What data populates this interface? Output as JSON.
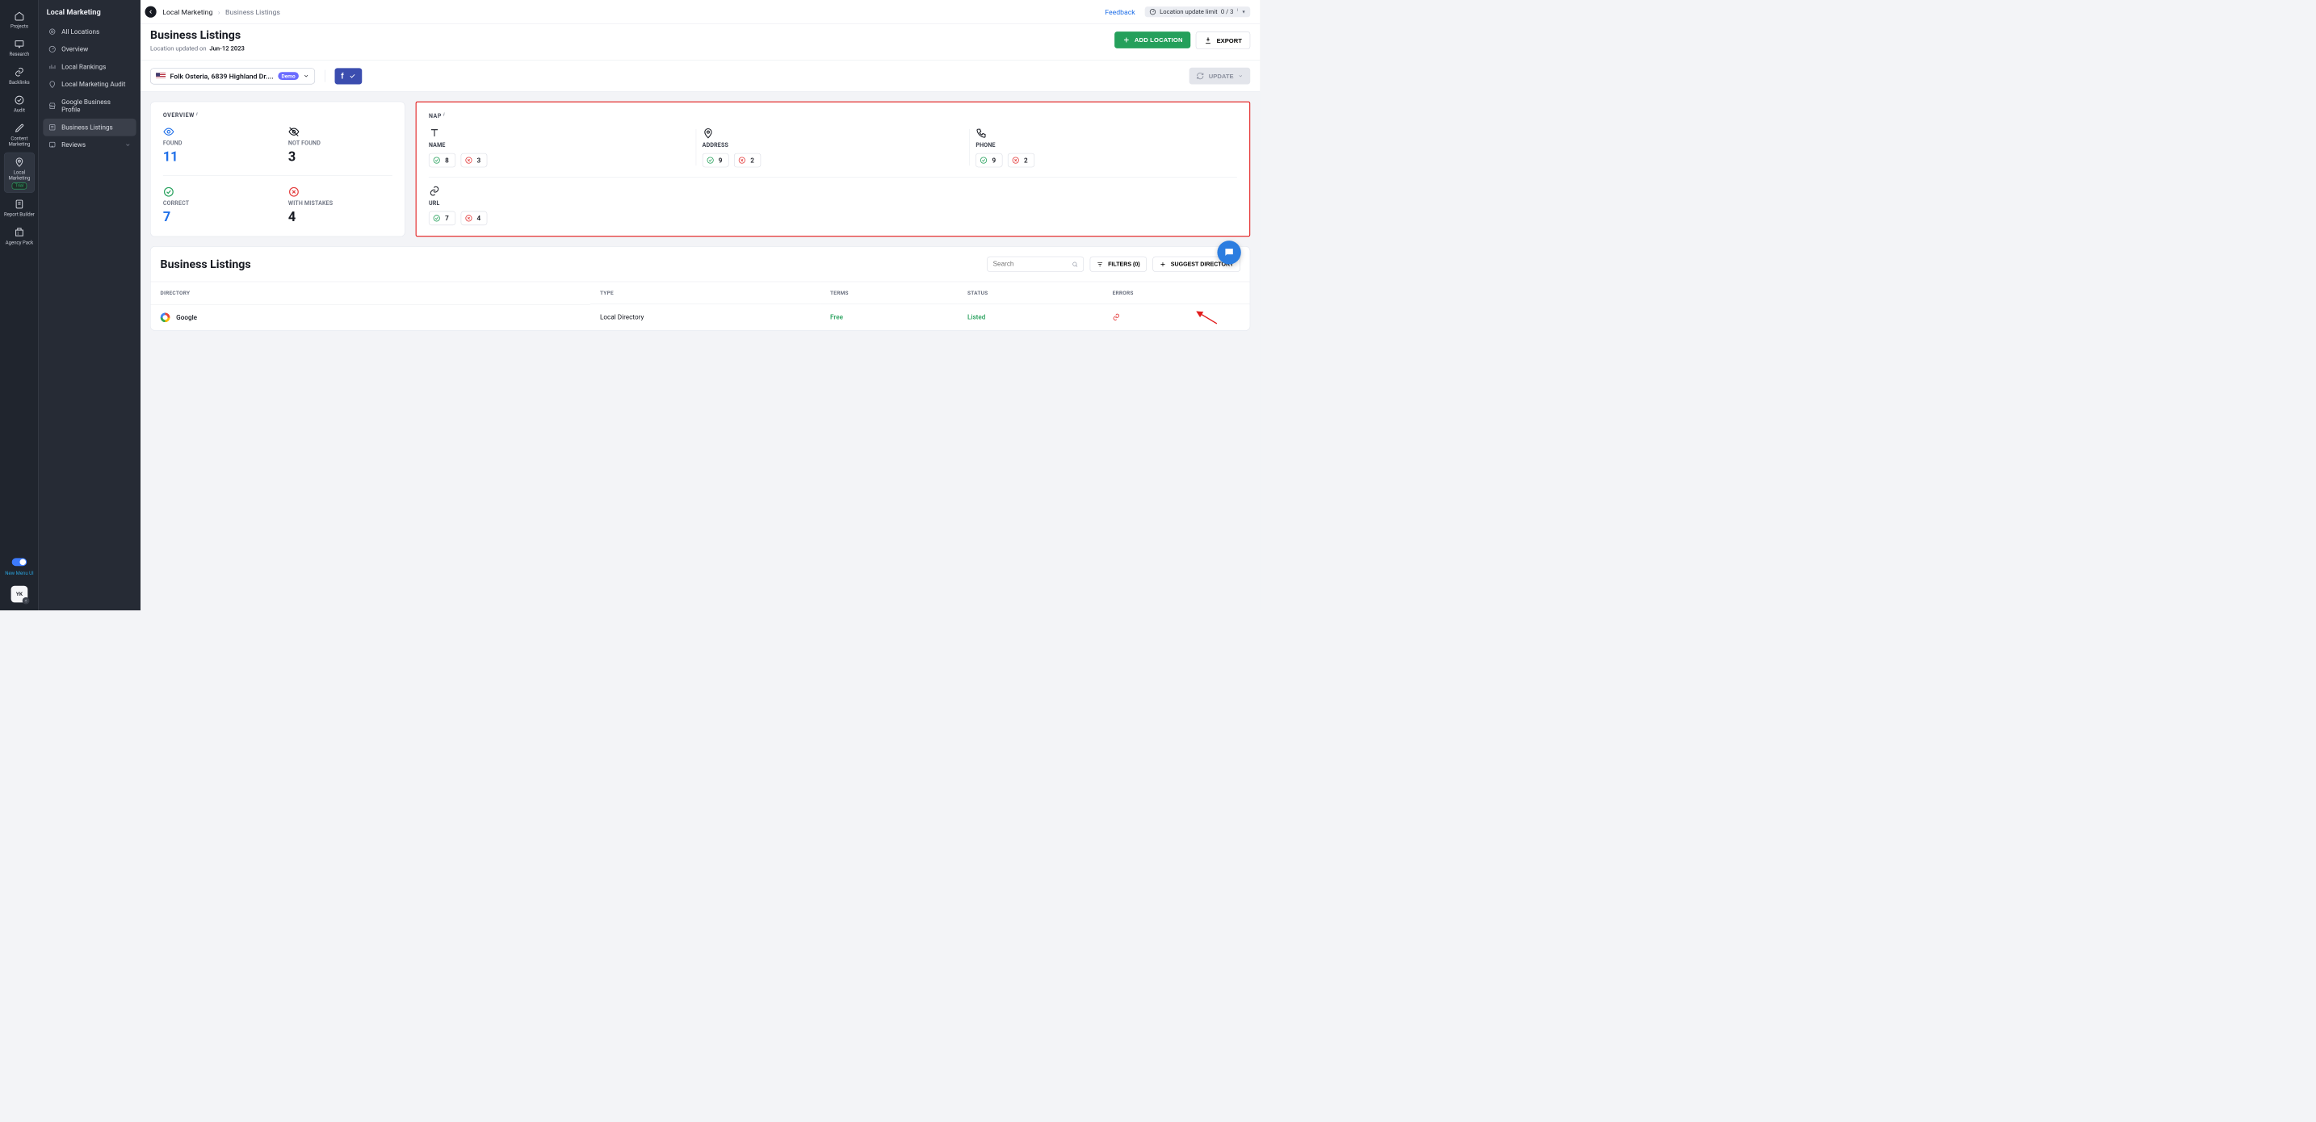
{
  "iconbar": {
    "items": [
      {
        "label": "Projects"
      },
      {
        "label": "Research"
      },
      {
        "label": "Backlinks"
      },
      {
        "label": "Audit"
      },
      {
        "label": "Content Marketing"
      },
      {
        "label": "Local Marketing",
        "trial": "Trial",
        "active": true
      },
      {
        "label": "Report Builder"
      },
      {
        "label": "Agency Pack"
      }
    ],
    "menu_toggle_label": "New Menu UI",
    "user": "YK"
  },
  "subsidebar": {
    "title": "Local Marketing",
    "items": [
      {
        "label": "All Locations"
      },
      {
        "label": "Overview"
      },
      {
        "label": "Local Rankings"
      },
      {
        "label": "Local Marketing Audit"
      },
      {
        "label": "Google Business Profile"
      },
      {
        "label": "Business Listings",
        "active": true
      },
      {
        "label": "Reviews",
        "chevron": true
      }
    ]
  },
  "breadcrumb": {
    "root": "Local Marketing",
    "current": "Business Listings"
  },
  "feedback": "Feedback",
  "limit": {
    "label": "Location update limit",
    "value": "0 / 3"
  },
  "header": {
    "title": "Business Listings",
    "updated_prefix": "Location updated on",
    "updated_date": "Jun-12 2023",
    "add_label": "ADD LOCATION",
    "export_label": "EXPORT"
  },
  "controls": {
    "location_name": "Folk Osteria, 6839 Highland Dr....",
    "demo_badge": "Demo",
    "update_label": "UPDATE"
  },
  "overview": {
    "title": "OVERVIEW",
    "found": {
      "label": "FOUND",
      "value": "11"
    },
    "notfound": {
      "label": "NOT FOUND",
      "value": "3"
    },
    "correct": {
      "label": "CORRECT",
      "value": "7"
    },
    "mistakes": {
      "label": "WITH MISTAKES",
      "value": "4"
    }
  },
  "nap": {
    "title": "NAP",
    "cells": [
      {
        "label": "NAME",
        "ok": "8",
        "err": "3"
      },
      {
        "label": "ADDRESS",
        "ok": "9",
        "err": "2"
      },
      {
        "label": "PHONE",
        "ok": "9",
        "err": "2"
      },
      {
        "label": "URL",
        "ok": "7",
        "err": "4"
      }
    ]
  },
  "listings": {
    "title": "Business Listings",
    "search_placeholder": "Search",
    "filters_label": "FILTERS (0)",
    "suggest_label": "SUGGEST DIRECTORY",
    "columns": {
      "directory": "DIRECTORY",
      "type": "TYPE",
      "terms": "TERMS",
      "status": "STATUS",
      "errors": "ERRORS"
    },
    "rows": [
      {
        "directory": "Google",
        "type": "Local Directory",
        "terms": "Free",
        "status": "Listed"
      }
    ]
  }
}
